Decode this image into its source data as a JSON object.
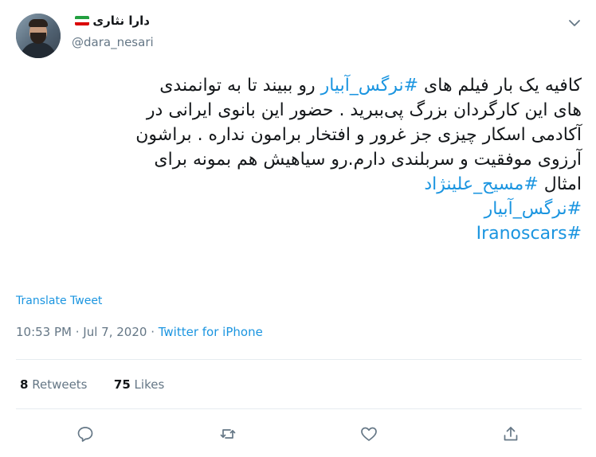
{
  "user": {
    "name": "دارا نثاری",
    "handle": "@dara_nesari",
    "flag": "iran-flag-icon"
  },
  "tweet": {
    "line1": {
      "a": "کافیه یک بار فیلم های ",
      "tag": "#نرگس_آبیار",
      "b": "  رو ببیند تا به توانمندی"
    },
    "line2": "های این کارگردان بزرگ پی‌ببرید . حضور این بانوی ایرانی در",
    "line3": "آکادمی اسکار چیزی جز غرور و افتخار برامون نداره . براشون",
    "line4": "آرزوی موفقیت و سربلندی دارم.رو سیاهیش هم بمونه برای",
    "line5": {
      "a": "امثال ",
      "tag": "#مسیح_علینژاد"
    },
    "tag6": "#نرگس_آبیار",
    "tag7": "#Iranoscars"
  },
  "translate_label": "Translate Tweet",
  "meta": {
    "time": "10:53 PM",
    "date": "Jul 7, 2020",
    "source": "Twitter for iPhone",
    "sep": " · "
  },
  "stats": {
    "retweets_count": "8",
    "retweets_label": "Retweets",
    "likes_count": "75",
    "likes_label": "Likes"
  },
  "colors": {
    "accent": "#1b95e0",
    "secondary_text": "#657786",
    "divider": "#e6ecf0"
  },
  "actions": [
    "reply-icon",
    "retweet-icon",
    "like-icon",
    "share-icon"
  ]
}
